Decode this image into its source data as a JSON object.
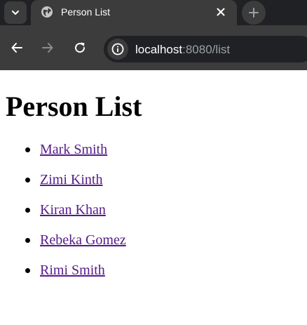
{
  "browser": {
    "tab_title": "Person List",
    "url_host": "localhost",
    "url_rest": ":8080/list"
  },
  "page": {
    "heading": "Person List",
    "persons": [
      {
        "name": "Mark Smith"
      },
      {
        "name": "Zimi Kinth"
      },
      {
        "name": "Kiran Khan"
      },
      {
        "name": "Rebeka Gomez"
      },
      {
        "name": "Rimi Smith"
      }
    ]
  },
  "colors": {
    "chrome_bg": "#3c3c3c",
    "tabstrip_bg": "#202124",
    "link_visited": "#551a8b"
  },
  "icons": {
    "tab_search": "chevron-down-icon",
    "favicon": "globe-icon",
    "close": "close-icon",
    "new_tab": "plus-icon",
    "back": "arrow-left-icon",
    "forward": "arrow-right-icon",
    "reload": "reload-icon",
    "site_info": "info-icon"
  }
}
